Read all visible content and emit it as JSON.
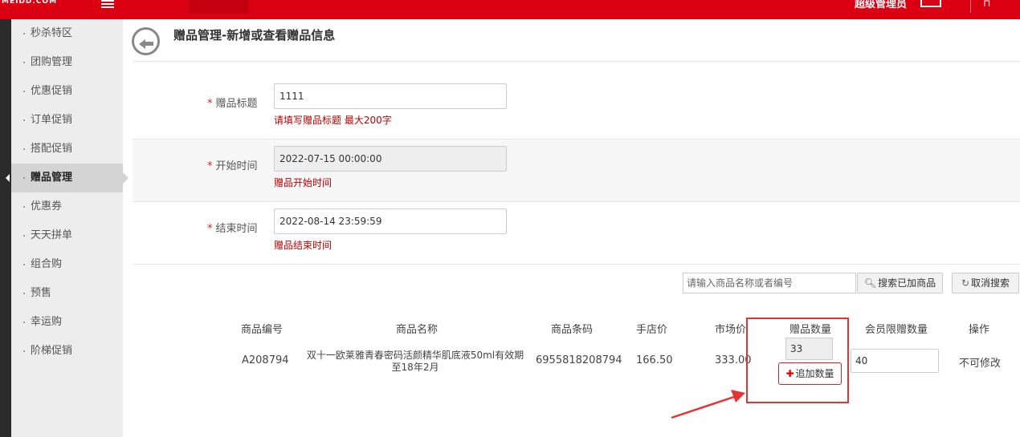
{
  "header": {
    "logo_text": "MEIDD.COM",
    "admin_name": "超级管理员"
  },
  "sidebar": {
    "items": [
      {
        "label": "秒杀特区"
      },
      {
        "label": "团购管理"
      },
      {
        "label": "优惠促销"
      },
      {
        "label": "订单促销"
      },
      {
        "label": "搭配促销"
      },
      {
        "label": "赠品管理",
        "active": true
      },
      {
        "label": "优惠券"
      },
      {
        "label": "天天拼单"
      },
      {
        "label": "组合购"
      },
      {
        "label": "预售"
      },
      {
        "label": "幸运购"
      },
      {
        "label": "阶梯促销"
      }
    ]
  },
  "page": {
    "title": "赠品管理-新增或查看赠品信息"
  },
  "form": {
    "title_label": "赠品标题",
    "title_value": "1111",
    "title_hint": "请填写赠品标题 最大200字",
    "start_label": "开始时间",
    "start_value": "2022-07-15 00:00:00",
    "start_hint": "赠品开始时间",
    "end_label": "结束时间",
    "end_value": "2022-08-14 23:59:59",
    "end_hint": "赠品结束时间",
    "required_mark": "*"
  },
  "search": {
    "placeholder": "请输入商品名称或者编号",
    "search_button": "搜索已加商品",
    "cancel_button": "取消搜索"
  },
  "table": {
    "headers": [
      "商品编号",
      "商品名称",
      "商品条码",
      "手店价",
      "市场价",
      "赠品数量",
      "会员限赠数量",
      "操作"
    ],
    "rows": [
      {
        "code": "A208794",
        "name": "双十一欧莱雅青春密码活颜精华肌底液50ml有效期至18年2月",
        "barcode": "6955818208794",
        "shop_price": "166.50",
        "market_price": "333.00",
        "gift_qty": "33",
        "add_qty_button": "追加数量",
        "member_limit": "40",
        "action": "不可修改"
      }
    ]
  },
  "colors": {
    "brand": "#db0011",
    "hint": "#b00000",
    "highlight": "#e53333"
  }
}
